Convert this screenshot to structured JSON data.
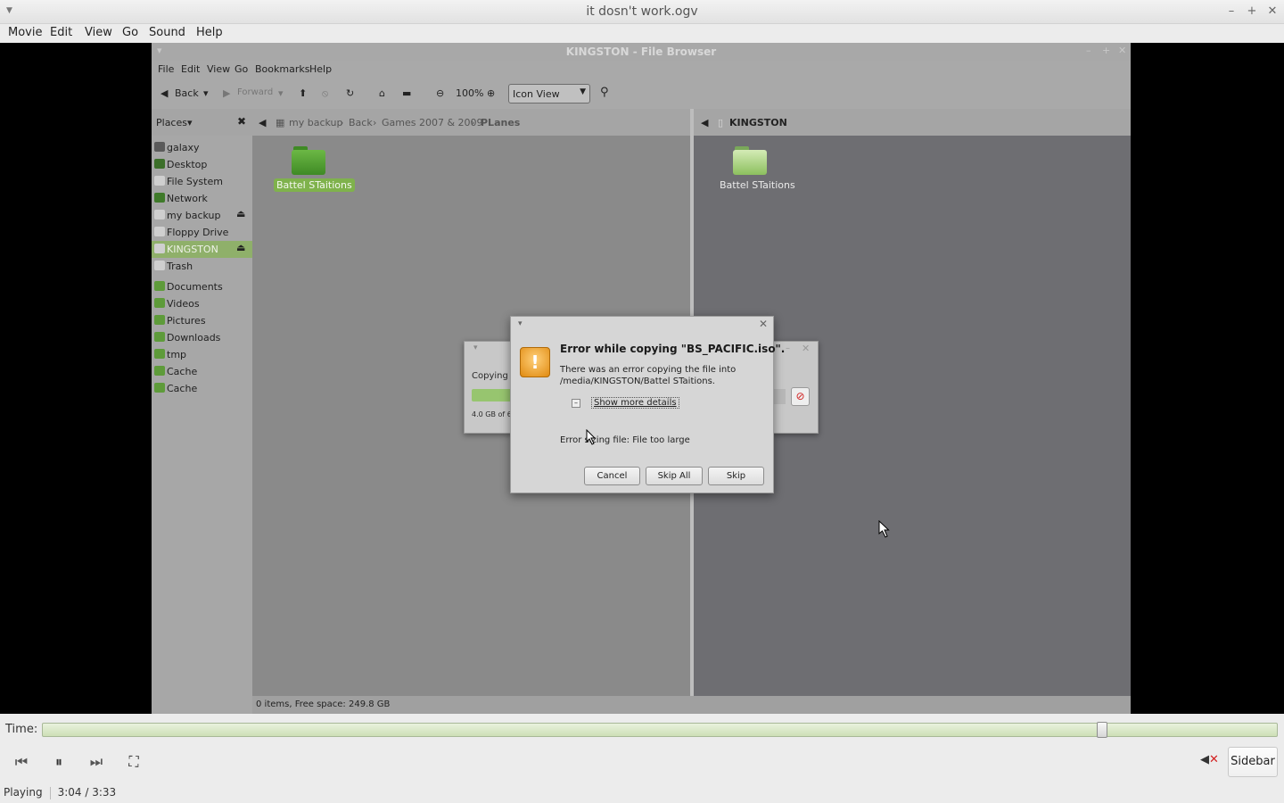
{
  "window": {
    "title": "it dosn't work.ogv"
  },
  "menubar": [
    "Movie",
    "Edit",
    "View",
    "Go",
    "Sound",
    "Help"
  ],
  "file_browser": {
    "title": "KINGSTON - File Browser",
    "menu": [
      "File",
      "Edit",
      "View",
      "Go",
      "Bookmarks",
      "Help"
    ],
    "toolbar": {
      "back": "Back",
      "forward": "Forward",
      "zoom": "100%",
      "view": "Icon View"
    },
    "places_label": "Places",
    "places": [
      {
        "label": "galaxy",
        "color": "#5a5a5a"
      },
      {
        "label": "Desktop",
        "color": "#3c6f2a"
      },
      {
        "label": "File System",
        "color": "#cfcfcf"
      },
      {
        "label": "Network",
        "color": "#3f7a2a"
      },
      {
        "label": "my backup",
        "color": "#cfcfcf"
      },
      {
        "label": "Floppy Drive",
        "color": "#cfcfcf"
      },
      {
        "label": "KINGSTON",
        "color": "#cfcfcf"
      },
      {
        "label": "Trash",
        "color": "#cfcfcf"
      },
      {
        "label": "Documents",
        "color": "#5e9b3a"
      },
      {
        "label": "Videos",
        "color": "#5e9b3a"
      },
      {
        "label": "Pictures",
        "color": "#5e9b3a"
      },
      {
        "label": "Downloads",
        "color": "#5e9b3a"
      },
      {
        "label": "tmp",
        "color": "#5e9b3a"
      },
      {
        "label": "Cache",
        "color": "#5e9b3a"
      },
      {
        "label": "Cache",
        "color": "#5e9b3a"
      }
    ],
    "left_path": [
      "my backup",
      "Back",
      "Games 2007 & 2009",
      "PLanes"
    ],
    "right_path": "KINGSTON",
    "left_folder": "Battel STaitions",
    "right_folder": "Battel STaitions",
    "status": "0 items, Free space: 249.8 GB",
    "progress": {
      "label": "Copying",
      "amount": "4.0 GB of 6"
    }
  },
  "dialog": {
    "heading": "Error while copying \"BS_PACIFIC.iso\".",
    "message": "There was an error copying the file into /media/KINGSTON/Battel STaitions.",
    "details_label": "Show more details",
    "error": "Error sizing file: File too large",
    "buttons": {
      "cancel": "Cancel",
      "skip_all": "Skip All",
      "skip": "Skip"
    }
  },
  "player": {
    "time_label": "Time:",
    "position_fraction": 0.8612,
    "sidebar_label": "Sidebar",
    "status": "Playing",
    "time": "3:04 / 3:33"
  }
}
